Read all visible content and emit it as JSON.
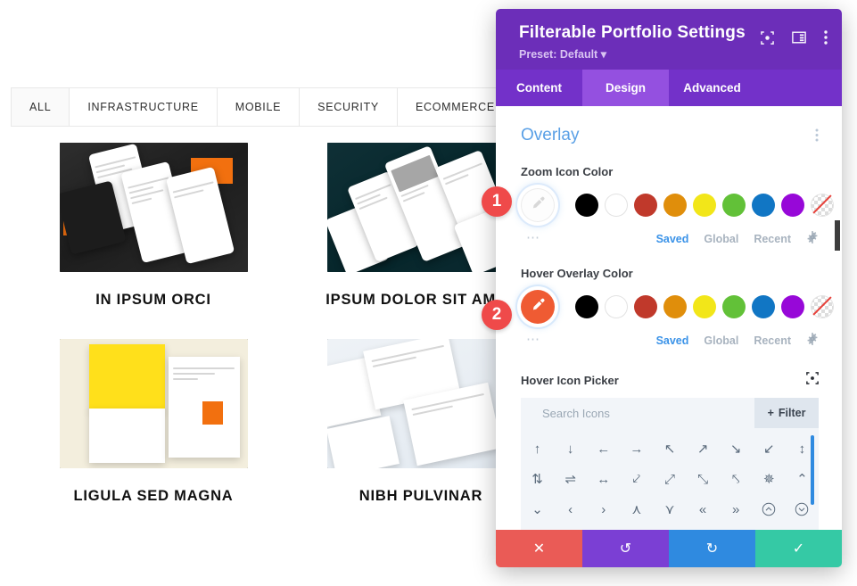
{
  "portfolio": {
    "filters": [
      {
        "label": "ALL",
        "active": true
      },
      {
        "label": "INFRASTRUCTURE",
        "active": false
      },
      {
        "label": "MOBILE",
        "active": false
      },
      {
        "label": "SECURITY",
        "active": false
      },
      {
        "label": "ECOMMERCE",
        "active": false
      }
    ],
    "items": [
      {
        "title": "IN IPSUM ORCI",
        "thumb": "dark-phone-mockups"
      },
      {
        "title": "IPSUM DOLOR SIT AMET",
        "thumb": "teal-phone-mockups"
      },
      {
        "title": "LIGULA SED MAGNA",
        "thumb": "yellow-page-mockups"
      },
      {
        "title": "NIBH PULVINAR",
        "thumb": "light-shop-mockups"
      }
    ]
  },
  "modal": {
    "title": "Filterable Portfolio Settings",
    "preset": "Preset: Default",
    "header_icons": [
      "focus-icon",
      "layout-icon",
      "kebab-menu-icon"
    ],
    "tabs": [
      {
        "label": "Content",
        "active": false
      },
      {
        "label": "Design",
        "active": true
      },
      {
        "label": "Advanced",
        "active": false
      }
    ],
    "section": {
      "title": "Overlay",
      "menu_icon": "kebab-menu-icon"
    },
    "zoom_icon_color": {
      "label": "Zoom Icon Color",
      "selected_value": "#ffffff",
      "selected_icon": "eyedropper-icon",
      "palette": [
        "#000000",
        "#ffffff",
        "#c0392b",
        "#e08e0b",
        "#f2e619",
        "#62c138",
        "#1176c4",
        "#9708d8",
        "transparent"
      ],
      "more_icon": "ellipsis-icon",
      "tabs": [
        {
          "label": "Saved",
          "active": true
        },
        {
          "label": "Global",
          "active": false
        },
        {
          "label": "Recent",
          "active": false
        }
      ],
      "settings_icon": "gear-icon"
    },
    "hover_overlay_color": {
      "label": "Hover Overlay Color",
      "selected_value": "#ef5b33",
      "selected_icon": "eyedropper-icon",
      "palette": [
        "#000000",
        "#ffffff",
        "#c0392b",
        "#e08e0b",
        "#f2e619",
        "#62c138",
        "#1176c4",
        "#9708d8",
        "transparent"
      ],
      "more_icon": "ellipsis-icon",
      "tabs": [
        {
          "label": "Saved",
          "active": true
        },
        {
          "label": "Global",
          "active": false
        },
        {
          "label": "Recent",
          "active": false
        }
      ],
      "settings_icon": "gear-icon"
    },
    "hover_icon_picker": {
      "label": "Hover Icon Picker",
      "reset_icon": "focus-icon",
      "search_placeholder": "Search Icons",
      "filter_label": "Filter",
      "filter_icon": "plus-icon",
      "icons": [
        "↑",
        "↓",
        "←",
        "→",
        "↖",
        "↗",
        "↘",
        "↙",
        "↕",
        "⇕",
        "⇌",
        "↔",
        "⇲",
        "⤢",
        "⤡",
        "⤢",
        "✥",
        "⌃",
        "⌄",
        "‹",
        "›",
        "⌃⌃",
        "⌄⌄",
        "«",
        "»",
        "⌃○",
        "⌄○"
      ]
    },
    "footer": [
      {
        "name": "cancel",
        "icon": "✕"
      },
      {
        "name": "undo",
        "icon": "↺"
      },
      {
        "name": "redo",
        "icon": "↻"
      },
      {
        "name": "save",
        "icon": "✓"
      }
    ]
  },
  "steps": [
    {
      "number": "1",
      "target": "zoom-icon-color"
    },
    {
      "number": "2",
      "target": "hover-overlay-color"
    }
  ]
}
